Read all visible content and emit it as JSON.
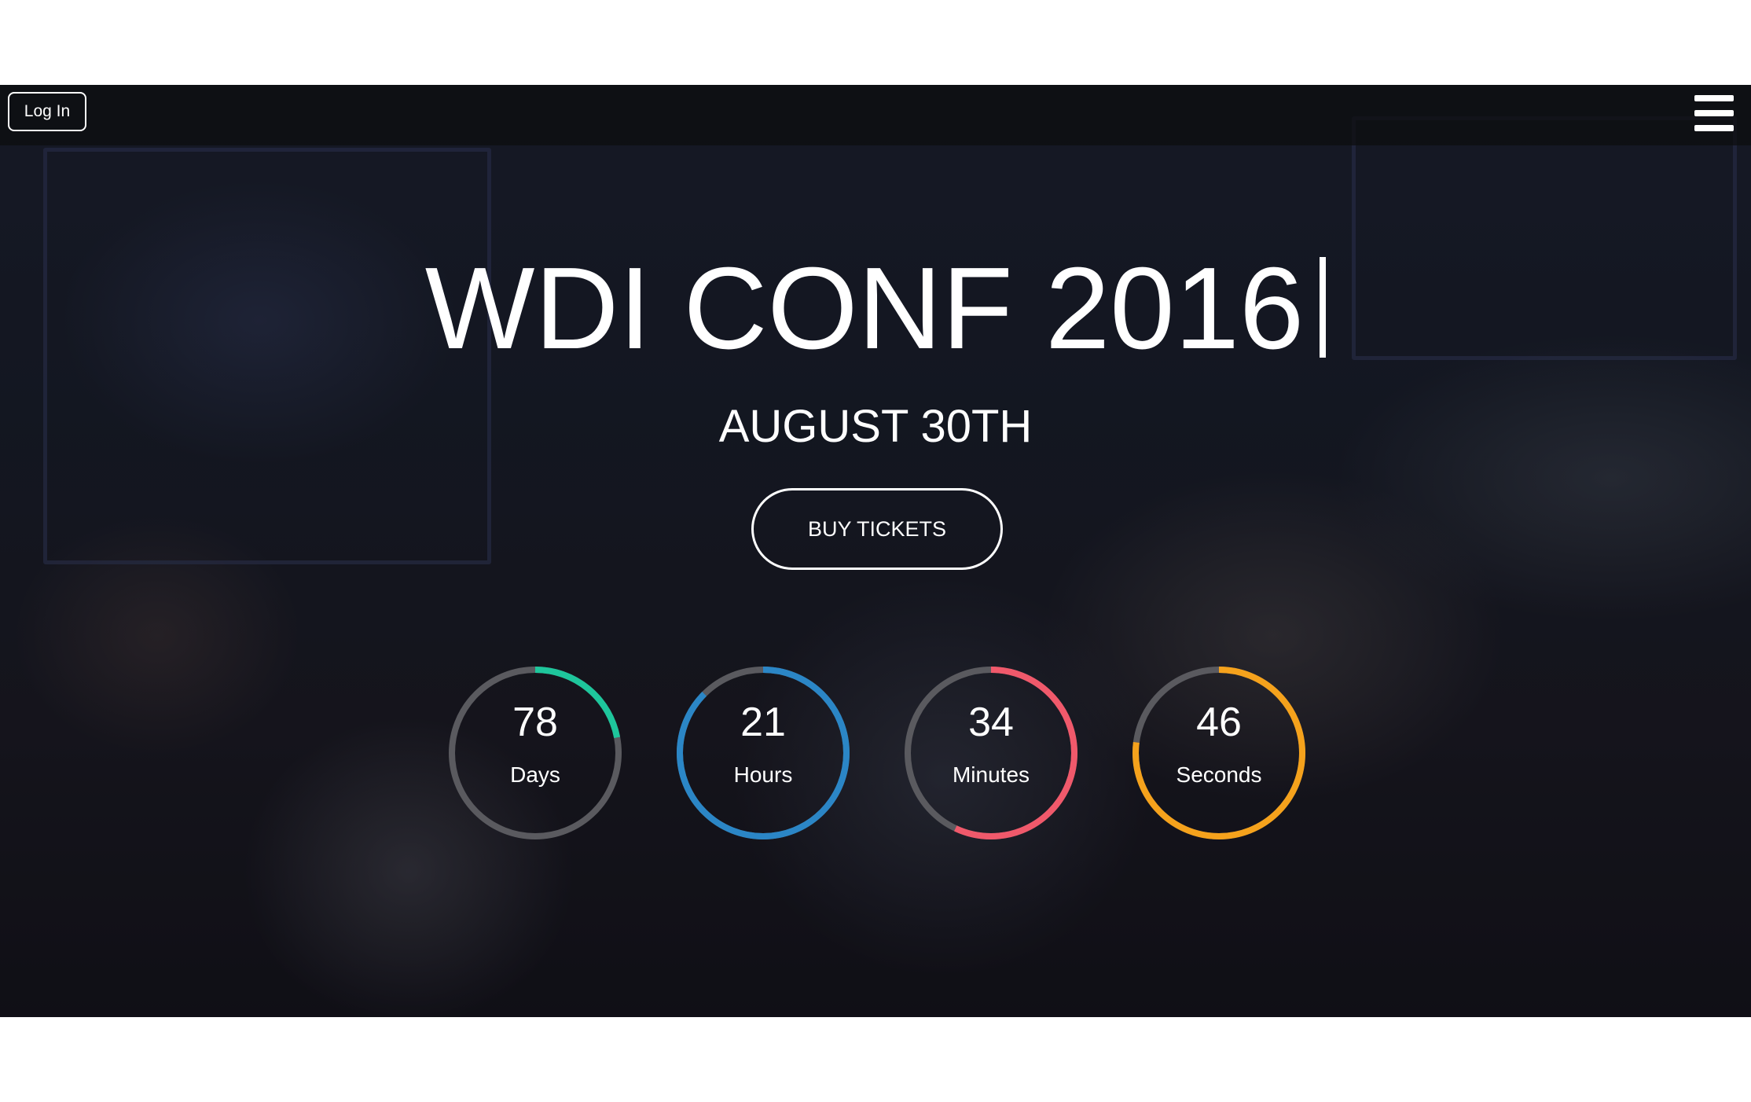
{
  "navbar": {
    "login_label": "Log In",
    "menu_icon": "hamburger-menu-icon"
  },
  "hero": {
    "title": "WDI CONF 2016",
    "date": "AUGUST 30TH",
    "cta_label": "BUY TICKETS"
  },
  "countdown": [
    {
      "value": "78",
      "label": "Days",
      "color": "#1ec69c",
      "progress": 0.22
    },
    {
      "value": "21",
      "label": "Hours",
      "color": "#2b86c6",
      "progress": 0.875
    },
    {
      "value": "34",
      "label": "Minutes",
      "color": "#f0596b",
      "progress": 0.57
    },
    {
      "value": "46",
      "label": "Seconds",
      "color": "#f5a21c",
      "progress": 0.77
    }
  ],
  "colors": {
    "track": "#5a5a5f",
    "text": "#ffffff"
  }
}
